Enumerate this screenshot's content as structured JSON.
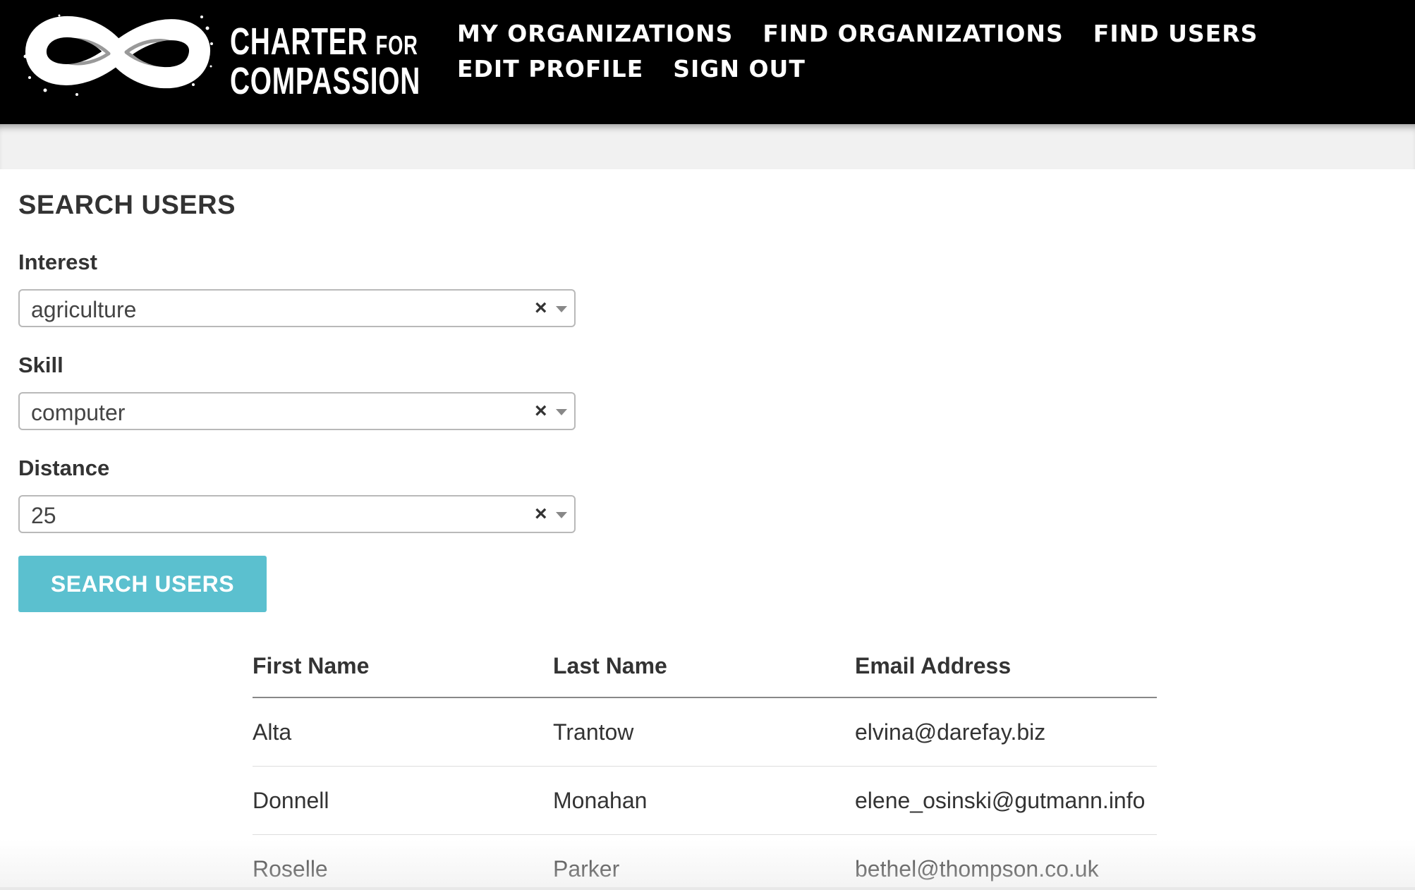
{
  "header": {
    "logo": {
      "line1_main": "CHARTER",
      "line1_small": "FOR",
      "line2": "COMPASSION"
    },
    "nav": {
      "row1": [
        "MY ORGANIZATIONS",
        "FIND ORGANIZATIONS",
        "FIND USERS"
      ],
      "row2": [
        "EDIT PROFILE",
        "SIGN OUT"
      ]
    }
  },
  "search": {
    "title": "SEARCH USERS",
    "fields": [
      {
        "label": "Interest",
        "value": "agriculture",
        "clear_glyph": "×"
      },
      {
        "label": "Skill",
        "value": "computer",
        "clear_glyph": "×"
      },
      {
        "label": "Distance",
        "value": "25",
        "clear_glyph": "×"
      }
    ],
    "button_label": "SEARCH USERS",
    "button_color": "#5bc0cf"
  },
  "results": {
    "columns": [
      "First Name",
      "Last Name",
      "Email Address"
    ],
    "rows": [
      [
        "Alta",
        "Trantow",
        "elvina@darefay.biz"
      ],
      [
        "Donnell",
        "Monahan",
        "elene_osinski@gutmann.info"
      ],
      [
        "Roselle",
        "Parker",
        "bethel@thompson.co.uk"
      ]
    ]
  },
  "icons": {
    "logo": "infinity-brush-logo",
    "clear": "clear-x-icon",
    "dropdown": "caret-down-icon"
  },
  "colors": {
    "header_bg": "#000000",
    "accent": "#5bc0cf",
    "text": "#333333"
  }
}
